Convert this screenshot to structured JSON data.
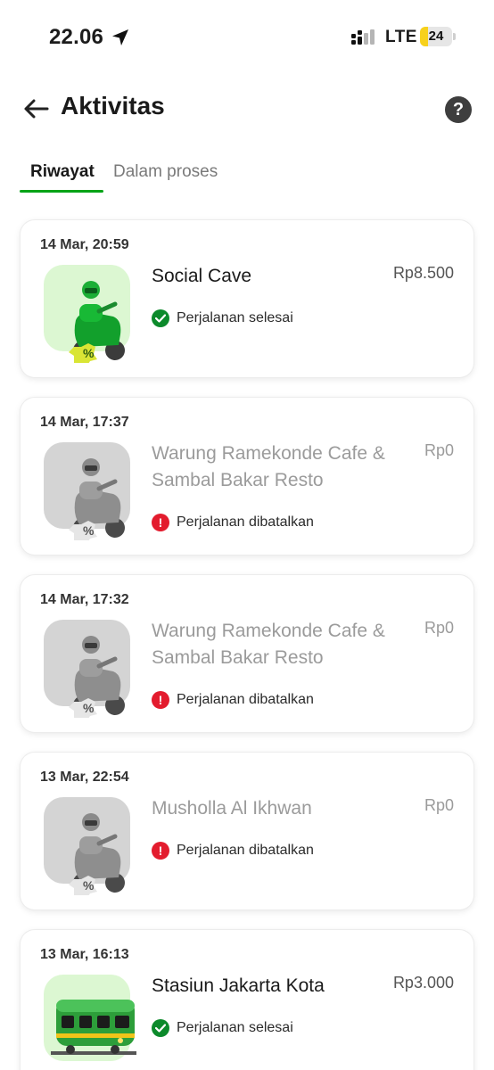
{
  "status_bar": {
    "time": "22.06",
    "network": "LTE",
    "battery": "24",
    "battery_level": 0.24
  },
  "header": {
    "title": "Aktivitas",
    "help_icon_label": "?"
  },
  "tabs": [
    {
      "label": "Riwayat",
      "active": true
    },
    {
      "label": "Dalam proses",
      "active": false
    }
  ],
  "activities": [
    {
      "date": "14 Mar, 20:59",
      "title": "Social Cave",
      "price": "Rp8.500",
      "status": "Perjalanan selesai",
      "state": "completed",
      "icon": "motorbike-ride-icon"
    },
    {
      "date": "14 Mar, 17:37",
      "title": "Warung Ramekonde Cafe & Sambal Bakar Resto",
      "price": "Rp0",
      "status": "Perjalanan dibatalkan",
      "state": "cancelled",
      "icon": "motorbike-ride-icon"
    },
    {
      "date": "14 Mar, 17:32",
      "title": "Warung Ramekonde Cafe & Sambal Bakar Resto",
      "price": "Rp0",
      "status": "Perjalanan dibatalkan",
      "state": "cancelled",
      "icon": "motorbike-ride-icon"
    },
    {
      "date": "13 Mar, 22:54",
      "title": "Musholla Al Ikhwan",
      "price": "Rp0",
      "status": "Perjalanan dibatalkan",
      "state": "cancelled",
      "icon": "motorbike-ride-icon"
    },
    {
      "date": "13 Mar, 16:13",
      "title": "Stasiun Jakarta Kota",
      "price": "Rp3.000",
      "status": "Perjalanan selesai",
      "state": "completed",
      "icon": "train-icon"
    }
  ],
  "colors": {
    "accent": "#00a316",
    "completed": "#0c8a2b",
    "cancelled": "#e31c2e",
    "battery": "#f7d11c"
  }
}
